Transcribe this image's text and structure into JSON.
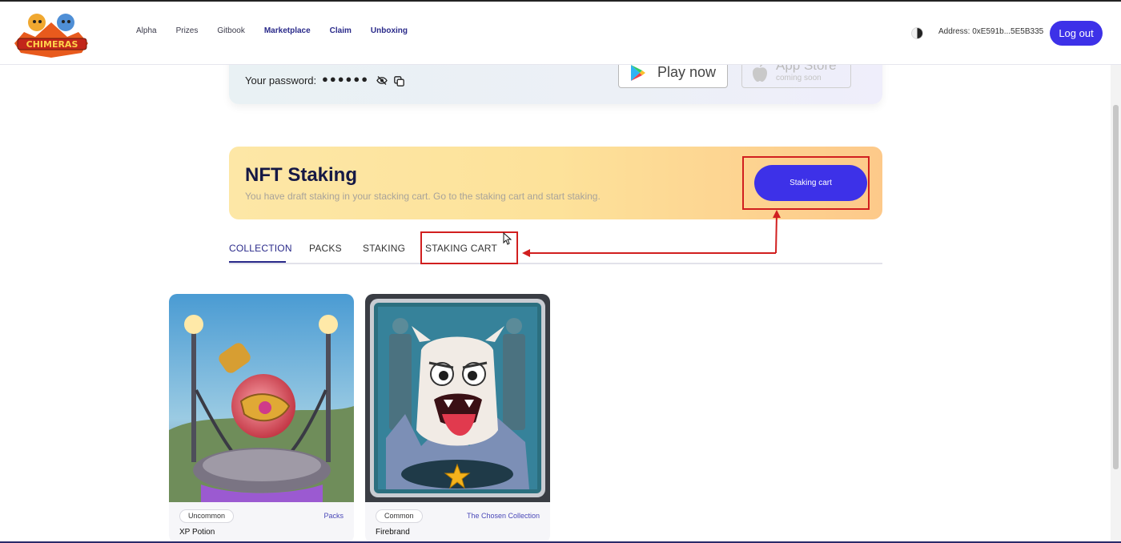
{
  "header": {
    "logo_text": "CHIMERAS",
    "nav": [
      "Alpha",
      "Prizes",
      "Gitbook",
      "Marketplace",
      "Claim",
      "Unboxing"
    ],
    "address": "Address: 0xE591b...5E5B335",
    "logout_label": "Log out"
  },
  "password_card": {
    "label": "Your password:",
    "masked_value": "●●●●●●",
    "play_label": "Play now",
    "apple_title": "App Store",
    "apple_sub": "coming soon"
  },
  "staking": {
    "title": "NFT Staking",
    "subtitle": "You have draft staking in your stacking cart. Go to the staking cart and start staking.",
    "cart_button": "Staking cart"
  },
  "tabs": [
    {
      "label": "COLLECTION",
      "active": true
    },
    {
      "label": "PACKS",
      "active": false
    },
    {
      "label": "STAKING",
      "active": false
    },
    {
      "label": "STAKING CART",
      "active": false
    }
  ],
  "cards": [
    {
      "rarity": "Uncommon",
      "collection": "Packs",
      "name": "XP Potion"
    },
    {
      "rarity": "Common",
      "collection": "The Chosen Collection",
      "name": "Firebrand"
    }
  ],
  "colors": {
    "accent": "#3d31e8",
    "annotation": "#d11f1f",
    "nav_bold": "#2a2a8a"
  }
}
